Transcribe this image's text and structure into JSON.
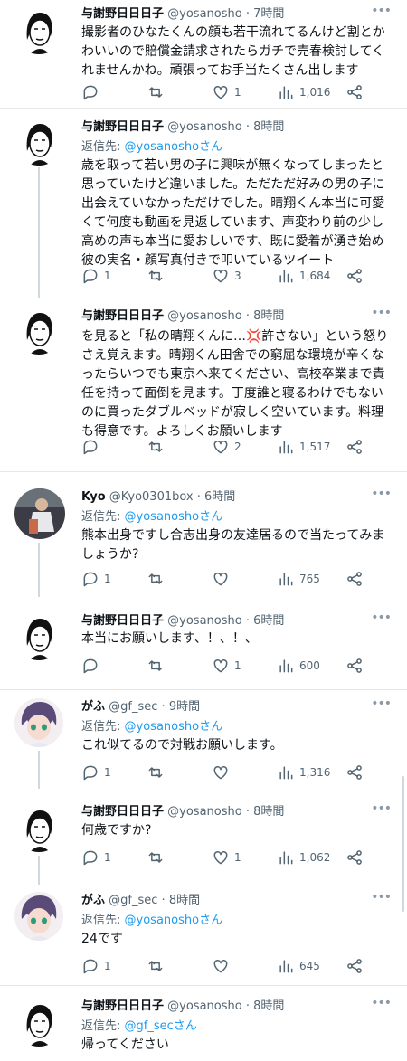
{
  "tweets": [
    {
      "name": "与謝野日日日子",
      "handle": "@yosanosho",
      "time": "7時間",
      "reply_to": null,
      "text": "撮影者のひなたくんの顔も若干流れてるんけど割とかわいいので賠償金請求されたらガチで売春検討してくれませんかね。頑張ってお手当たくさん出します",
      "replies": "",
      "retweets": "",
      "likes": "1",
      "views": "1,016"
    },
    {
      "name": "与謝野日日日子",
      "handle": "@yosanosho",
      "time": "8時間",
      "reply_label": "返信先:",
      "reply_to": "@yosanoshoさん",
      "text": "歳を取って若い男の子に興味が無くなってしまったと思っていたけど違いました。ただただ好みの男の子に出会えていなかっただけでした。晴翔くん本当に可愛くて何度も動画を見返しています、声変わり前の少し高めの声も本当に愛おしいです、既に愛着が湧き始め彼の実名・顔写真付きで叩いているツイート",
      "replies": "1",
      "retweets": "",
      "likes": "3",
      "views": "1,684"
    },
    {
      "name": "与謝野日日日子",
      "handle": "@yosanosho",
      "time": "8時間",
      "reply_to": null,
      "text": "を見ると「私の晴翔くんに…💢許さない」という怒りさえ覚えます。晴翔くん田舎での窮屈な環境が辛くなったらいつでも東京へ来てください、高校卒業まで責任を持って面倒を見ます。丁度誰と寝るわけでもないのに買ったダブルベッドが寂しく空いています。料理も得意です。よろしくお願いします",
      "replies": "",
      "retweets": "",
      "likes": "2",
      "views": "1,517"
    },
    {
      "name": "Kyo",
      "handle": "@Kyo0301box",
      "time": "6時間",
      "reply_label": "返信先:",
      "reply_to": "@yosanoshoさん",
      "text": "熊本出身ですし合志出身の友達居るので当たってみましょうか?",
      "replies": "1",
      "retweets": "",
      "likes": "",
      "views": "765"
    },
    {
      "name": "与謝野日日日子",
      "handle": "@yosanosho",
      "time": "6時間",
      "reply_to": null,
      "text": "本当にお願いします、！、！、",
      "replies": "",
      "retweets": "",
      "likes": "1",
      "views": "600"
    },
    {
      "name": "がふ",
      "handle": "@gf_sec",
      "time": "9時間",
      "reply_label": "返信先:",
      "reply_to": "@yosanoshoさん",
      "text": "これ似てるので対戦お願いします。",
      "replies": "1",
      "retweets": "",
      "likes": "",
      "views": "1,316"
    },
    {
      "name": "与謝野日日日子",
      "handle": "@yosanosho",
      "time": "8時間",
      "reply_to": null,
      "text": "何歳ですか?",
      "replies": "1",
      "retweets": "",
      "likes": "1",
      "views": "1,062"
    },
    {
      "name": "がふ",
      "handle": "@gf_sec",
      "time": "8時間",
      "reply_label": "返信先:",
      "reply_to": "@yosanoshoさん",
      "text": "24です",
      "replies": "1",
      "retweets": "",
      "likes": "",
      "views": "645"
    },
    {
      "name": "与謝野日日日子",
      "handle": "@yosanosho",
      "time": "8時間",
      "reply_label": "返信先:",
      "reply_to": "@gf_secさん",
      "text": "帰ってください",
      "replies": "",
      "retweets": "",
      "likes": "",
      "views": ""
    }
  ],
  "icons": {
    "reply": "reply-icon",
    "retweet": "retweet-icon",
    "like": "heart-icon",
    "views": "views-icon",
    "share": "share-icon",
    "more": "more-icon"
  }
}
